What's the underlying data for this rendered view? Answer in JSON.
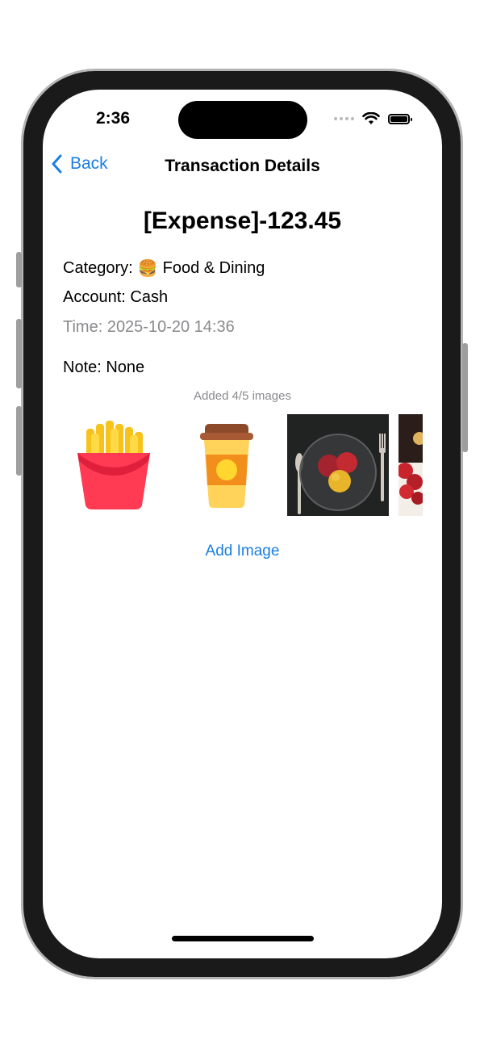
{
  "status": {
    "time": "2:36",
    "icons": [
      "signal-dots-icon",
      "wifi-icon",
      "battery-icon"
    ]
  },
  "nav": {
    "back_label": "Back",
    "title": "Transaction Details"
  },
  "transaction": {
    "amount": "[Expense]-123.45",
    "category_label": "Category:",
    "category_emoji": "🍔",
    "category_value": "Food & Dining",
    "account": "Account: Cash",
    "time": "Time: 2025-10-20 14:36",
    "note": "Note: None"
  },
  "images": {
    "count_text": "Added 4/5 images",
    "items": [
      "french-fries-image",
      "coffee-cup-image",
      "fruit-bowl-photo",
      "strawberries-photo"
    ],
    "add_label": "Add Image"
  },
  "colors": {
    "accent": "#1a7fe0",
    "secondary_text": "#8a8a8e"
  }
}
